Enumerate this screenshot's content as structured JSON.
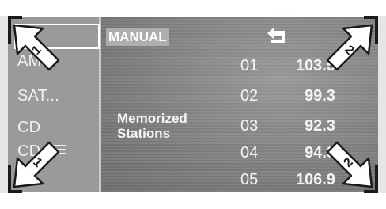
{
  "menu": {
    "items": [
      "AM...",
      "SAT...",
      "CD",
      "CD"
    ]
  },
  "mode_badge": "MANUAL",
  "memorized_label": [
    "Memorized",
    "Stations"
  ],
  "stations": [
    {
      "number": "01",
      "frequency": "103.5"
    },
    {
      "number": "02",
      "frequency": "99.3"
    },
    {
      "number": "03",
      "frequency": "92.3"
    },
    {
      "number": "04",
      "frequency": "94.3"
    },
    {
      "number": "05",
      "frequency": "106.9"
    }
  ],
  "arrow_labels": {
    "top_left": "1",
    "top_right": "2",
    "bottom_left": "1",
    "bottom_right": "2"
  }
}
